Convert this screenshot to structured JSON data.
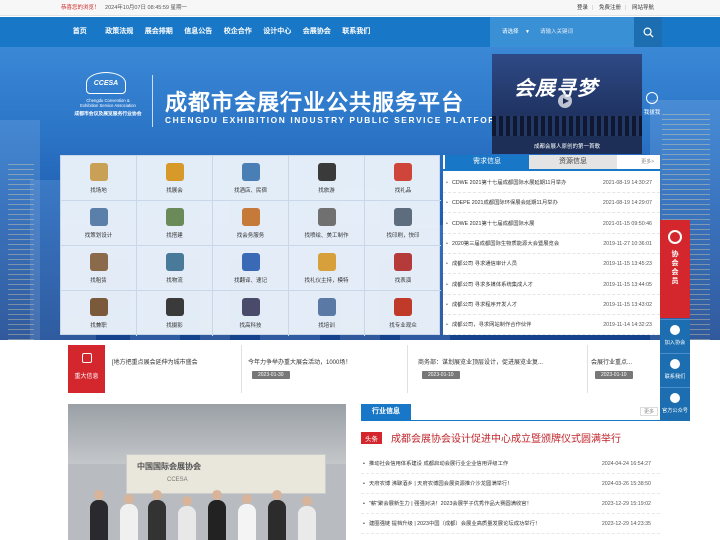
{
  "topbar": {
    "welcome": "恭喜您的浏览！",
    "datetime": "2024年10月07日 08:45:59 星期一",
    "login": "登录",
    "register": "免费注册",
    "sitemap": "网站导航"
  },
  "nav": {
    "items": [
      "首页",
      "政策法规",
      "展会排期",
      "信息公告",
      "校企合作",
      "设计中心",
      "会展协会",
      "联系我们"
    ],
    "select": "请选择",
    "search_placeholder": "请输入关键词"
  },
  "banner": {
    "logo_text": "CCESA",
    "logo_en1": "Chengdu Convention &",
    "logo_en2": "Exhibition Service Association",
    "logo_cn": "成都市会议及展览服务行业协会",
    "title_cn": "成都市会展行业公共服务平台",
    "title_en": "CHENGDU EXHIBITION INDUSTRY PUBLIC SERVICE PLATFORM",
    "video_title": "会展寻梦",
    "video_caption": "成都会展人原创的第一首歌",
    "police": "我拔我"
  },
  "grid": [
    {
      "label": "找场地",
      "color": "#c8a056"
    },
    {
      "label": "找展会",
      "color": "#d79a2a"
    },
    {
      "label": "找酒店、民宿",
      "color": "#4a7fb5"
    },
    {
      "label": "找旅游",
      "color": "#3a3a3a"
    },
    {
      "label": "找礼品",
      "color": "#d0453a"
    },
    {
      "label": "找策划设计",
      "color": "#5a7fa8"
    },
    {
      "label": "找搭建",
      "color": "#6a8a5a"
    },
    {
      "label": "找会务服务",
      "color": "#c57a3a"
    },
    {
      "label": "找喷绘、美工制作",
      "color": "#707070"
    },
    {
      "label": "找印刷，快印",
      "color": "#5d6d7e"
    },
    {
      "label": "找租赁",
      "color": "#8a6a4a"
    },
    {
      "label": "找物流",
      "color": "#4a7a9a"
    },
    {
      "label": "找翻译、速记",
      "color": "#3a6ab5"
    },
    {
      "label": "找礼仪主持，模特",
      "color": "#d7a03a"
    },
    {
      "label": "找表演",
      "color": "#b53a3a"
    },
    {
      "label": "找兼职",
      "color": "#7a5a3a"
    },
    {
      "label": "找摄影",
      "color": "#3a3a3a"
    },
    {
      "label": "找高科技",
      "color": "#4a4a6a"
    },
    {
      "label": "找培训",
      "color": "#5a7aa5"
    },
    {
      "label": "找专业观众",
      "color": "#c03a2a"
    }
  ],
  "news": {
    "tab1": "需求信息",
    "tab2": "资源信息",
    "more": "更多>",
    "items": [
      {
        "title": "CDWE 2021第十七届成都国际水展延期11月举办",
        "date": "2021-08-19 14:30:27"
      },
      {
        "title": "CDEPE 2021成都国际环保展会延期11月举办",
        "date": "2021-08-19 14:29:07"
      },
      {
        "title": "CDWE 2021第十七届成都国际水展",
        "date": "2021-01-15 09:50:46"
      },
      {
        "title": "2020第三届成都国际生物质能源大会暨展览会",
        "date": "2019-11-27 10:36:01"
      },
      {
        "title": "成都公司 寻求通信审计人员",
        "date": "2019-11-15 13:45:23"
      },
      {
        "title": "成都公司 寻求多媒体系统集成人才",
        "date": "2019-11-15 13:44:05"
      },
      {
        "title": "成都公司 寻求程序开发人才",
        "date": "2019-11-15 13:43:02"
      },
      {
        "title": "成都公司，寻求网站制作合作伙伴",
        "date": "2019-11-14 14:32:23"
      }
    ]
  },
  "sidebar": {
    "join": "协会会员",
    "add": "加入协会",
    "contact": "联系我们",
    "wechat": "官方公众号"
  },
  "ticker": {
    "label": "重大信息",
    "items": [
      {
        "title": "[地方把重点展会延伸为城市盛会",
        "date": "2023-01-10"
      },
      {
        "title": "今年力争举办重大展会活动，1000场！",
        "date": "2023-01-30"
      },
      {
        "title": "商务部：谋划展览业顶层设计，促进展览业复...",
        "date": "2023-01-10"
      },
      {
        "title": "会展行业重点...",
        "date": "2023-01-10"
      }
    ]
  },
  "photo": {
    "board_line1": "中国国际会展协会",
    "board_line2": "CCESA"
  },
  "industry": {
    "tab": "行业信息",
    "more": "更多",
    "headline_tag": "头条",
    "headline": "成都会展协会设计促进中心成立暨颁牌仪式圆满举行",
    "items": [
      {
        "title": "推动社会信用体系建设 成都启动会展行业企业信用评级工作",
        "date": "2024-04-24 16:54:27"
      },
      {
        "title": "天府农博 沸聊酒乡 | 天府农博园会展资源推介沙龙圆满举行！",
        "date": "2024-03-26 15:38:50"
      },
      {
        "title": "\"薪\"聚会展新生力 | 强强对决！2023会展学子优秀作品大赛圆满收官！",
        "date": "2023-12-29 15:19:02"
      },
      {
        "title": "建圈强链 提档升级 | 2023中国（成都）会展业高质量发展论坛成功举行！",
        "date": "2023-12-29 14:23:35"
      }
    ]
  }
}
